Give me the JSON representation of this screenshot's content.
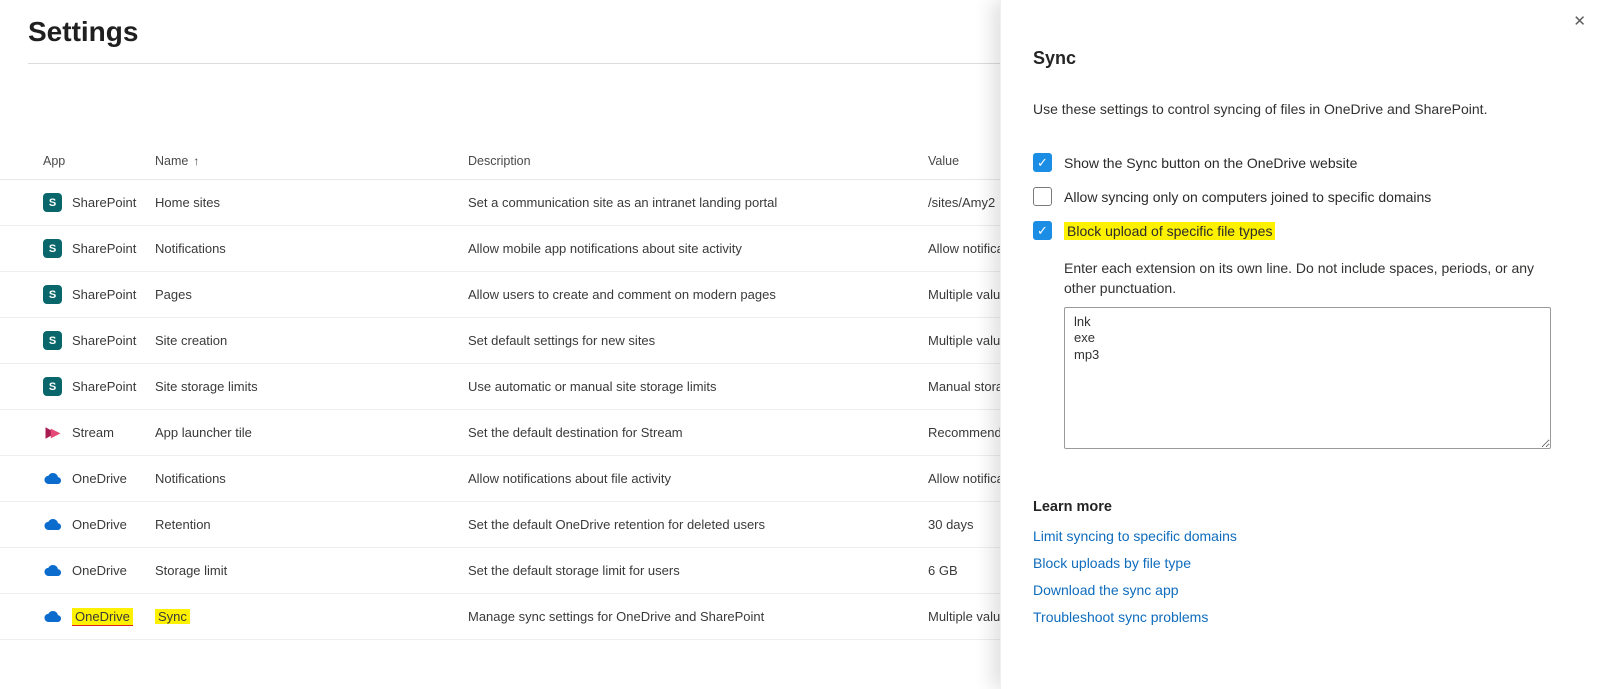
{
  "page": {
    "title": "Settings"
  },
  "colors": {
    "accent": "#1b8de4",
    "link": "#0f6cbd",
    "highlight": "#fdf100",
    "annotation_underline": "#e0241b",
    "sharepoint": "#09676b",
    "onedrive": "#0b6ccd",
    "stream": "#c22a5e"
  },
  "icons": {
    "sharepoint_glyph": "S"
  },
  "table": {
    "headers": {
      "app": "App",
      "sort_icon": "↑",
      "name": "Name",
      "description": "Description",
      "value": "Value"
    },
    "rows": [
      {
        "app": "SharePoint",
        "name": "Home sites",
        "description": "Set a communication site as an intranet landing portal",
        "value": "/sites/Amy2"
      },
      {
        "app": "SharePoint",
        "name": "Notifications",
        "description": "Allow mobile app notifications about site activity",
        "value": "Allow notificati"
      },
      {
        "app": "SharePoint",
        "name": "Pages",
        "description": "Allow users to create and comment on modern pages",
        "value": "Multiple values"
      },
      {
        "app": "SharePoint",
        "name": "Site creation",
        "description": "Set default settings for new sites",
        "value": "Multiple values"
      },
      {
        "app": "SharePoint",
        "name": "Site storage limits",
        "description": "Use automatic or manual site storage limits",
        "value": "Manual storag"
      },
      {
        "app": "Stream",
        "name": "App launcher tile",
        "description": "Set the default destination for Stream",
        "value": "Recommended"
      },
      {
        "app": "OneDrive",
        "name": "Notifications",
        "description": "Allow notifications about file activity",
        "value": "Allow notificati"
      },
      {
        "app": "OneDrive",
        "name": "Retention",
        "description": "Set the default OneDrive retention for deleted users",
        "value": "30 days"
      },
      {
        "app": "OneDrive",
        "name": "Storage limit",
        "description": "Set the default storage limit for users",
        "value": "6 GB"
      },
      {
        "app": "OneDrive",
        "name": "Sync",
        "description": "Manage sync settings for OneDrive and SharePoint",
        "value": "Multiple values",
        "highlight": true
      }
    ]
  },
  "panel": {
    "close_icon": "✕",
    "check_glyph": "✓",
    "title": "Sync",
    "description": "Use these settings to control syncing of files in OneDrive and SharePoint.",
    "options": [
      {
        "label": "Show the Sync button on the OneDrive website",
        "checked": true,
        "highlight": false
      },
      {
        "label": "Allow syncing only on computers joined to specific domains",
        "checked": false,
        "highlight": false
      },
      {
        "label": "Block upload of specific file types",
        "checked": true,
        "highlight": true
      }
    ],
    "extensions_help": "Enter each extension on its own line. Do not include spaces, periods, or any other punctuation.",
    "extensions_value": "lnk\nexe\nmp3",
    "learn_more_label": "Learn more",
    "links": [
      "Limit syncing to specific domains",
      "Block uploads by file type",
      "Download the sync app",
      "Troubleshoot sync problems"
    ]
  }
}
